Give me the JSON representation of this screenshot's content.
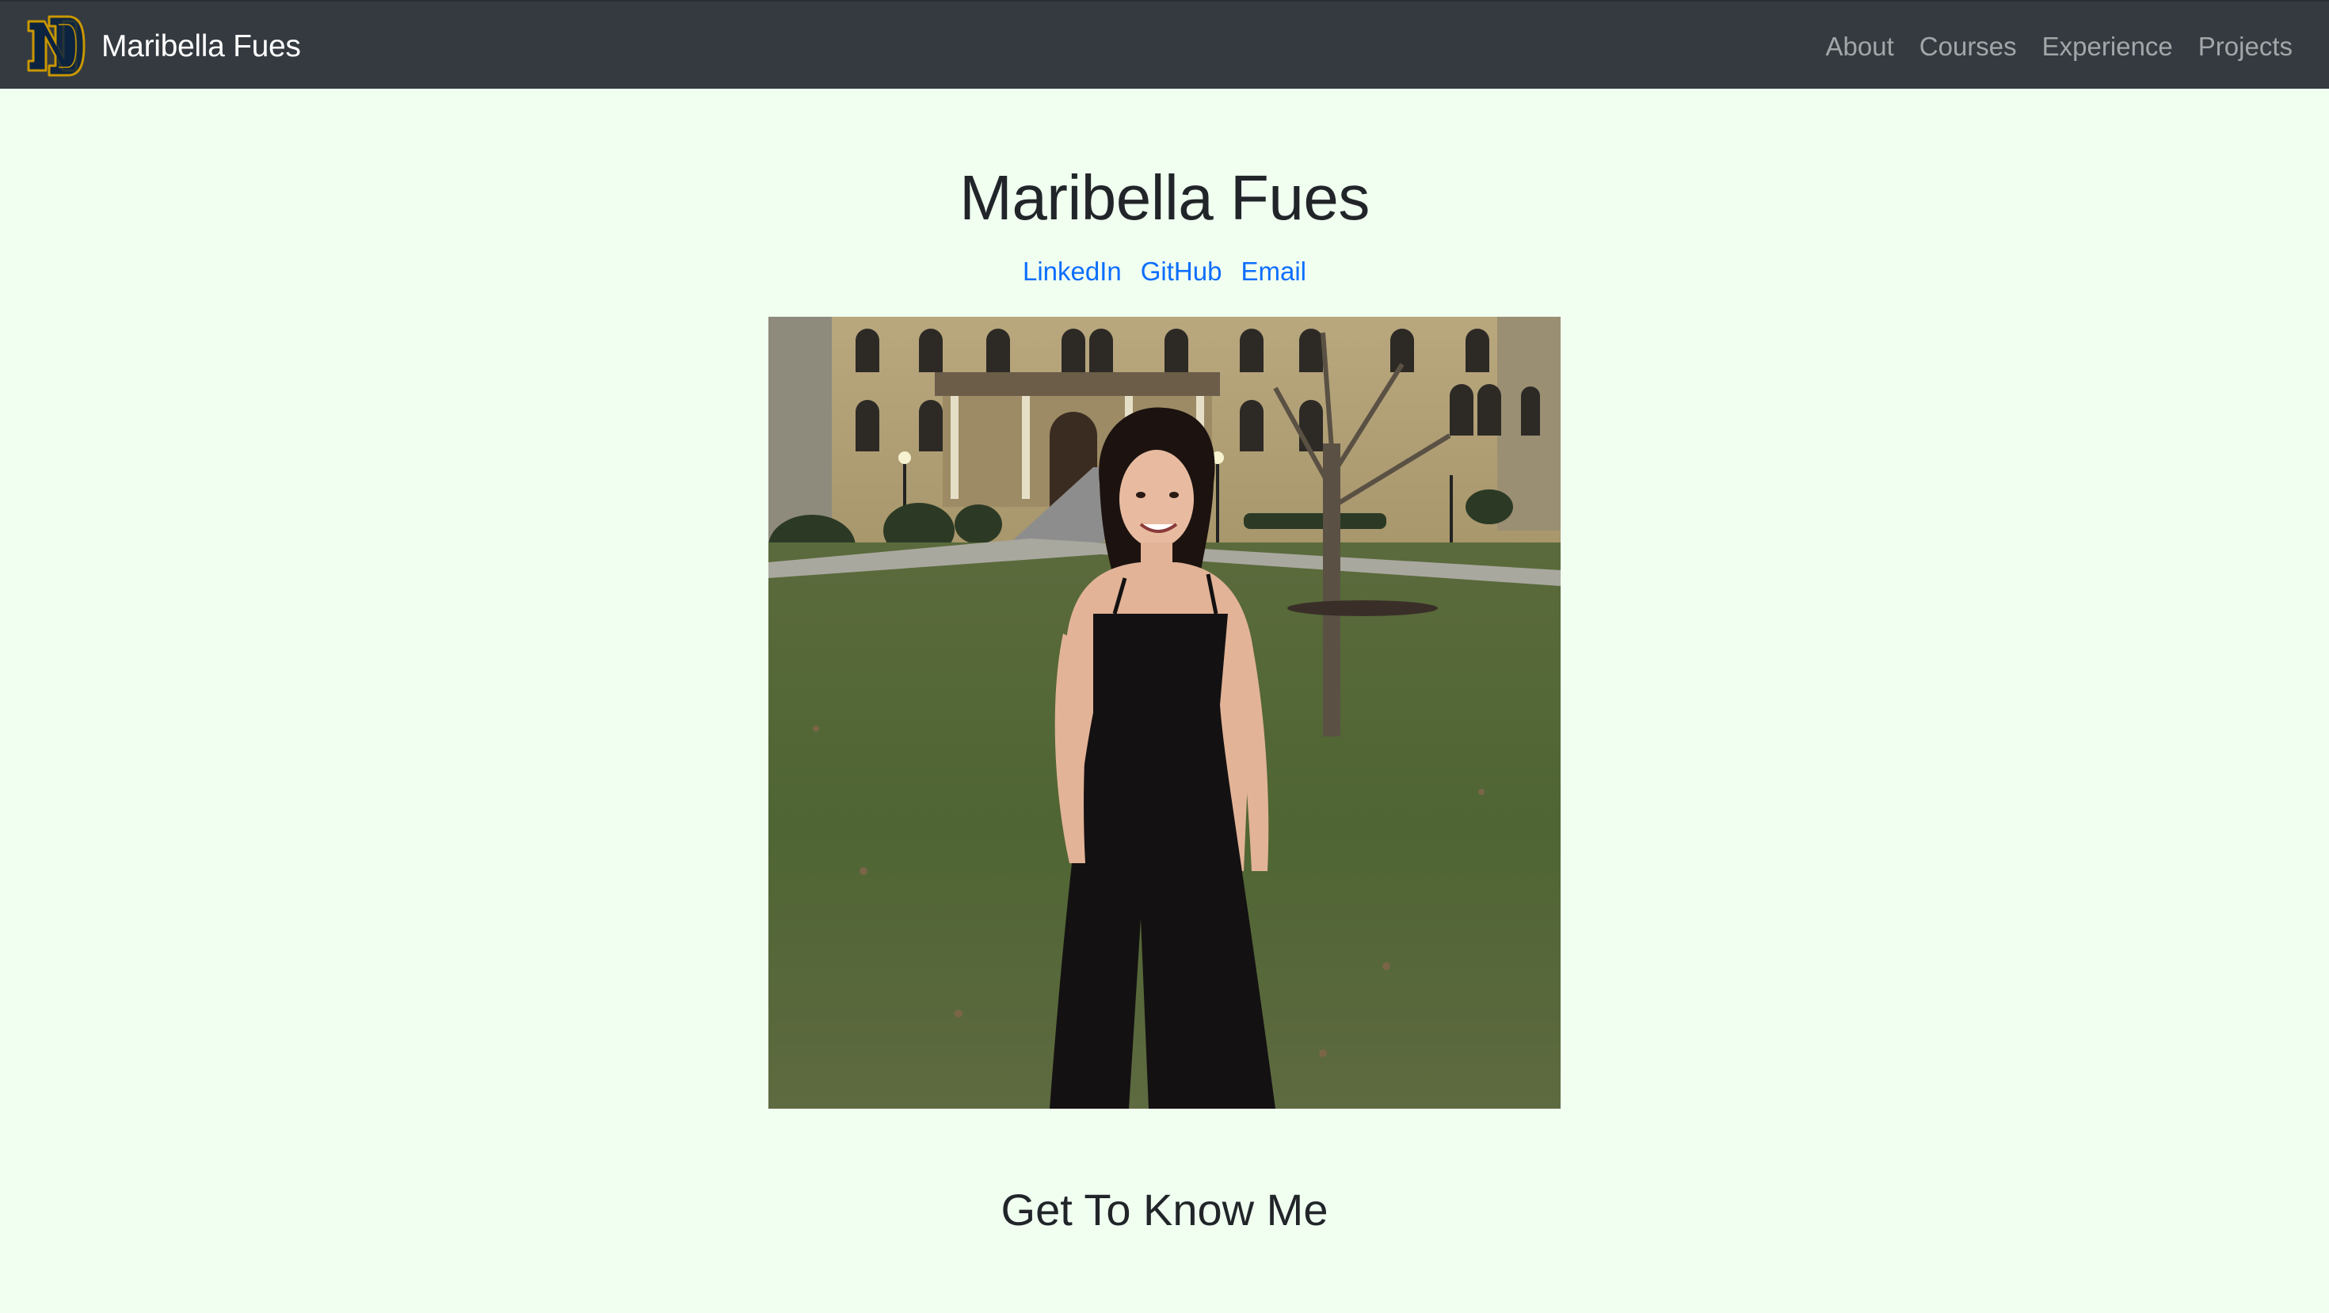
{
  "navbar": {
    "logo_icon": "nd-monogram-icon",
    "brand_name": "Maribella Fues",
    "links": [
      {
        "label": "About"
      },
      {
        "label": "Courses"
      },
      {
        "label": "Experience"
      },
      {
        "label": "Projects"
      }
    ]
  },
  "hero": {
    "title": "Maribella Fues",
    "social_links": [
      {
        "label": "LinkedIn"
      },
      {
        "label": "GitHub"
      },
      {
        "label": "Email"
      }
    ],
    "photo_icon": "portrait-photo"
  },
  "about": {
    "title": "Get To Know Me"
  },
  "colors": {
    "navbar_bg": "#343a40",
    "page_bg": "#f0fff0",
    "link": "#0d6efd",
    "nav_link": "#9a9da0",
    "logo_navy": "#0c2340",
    "logo_gold": "#c99700"
  }
}
